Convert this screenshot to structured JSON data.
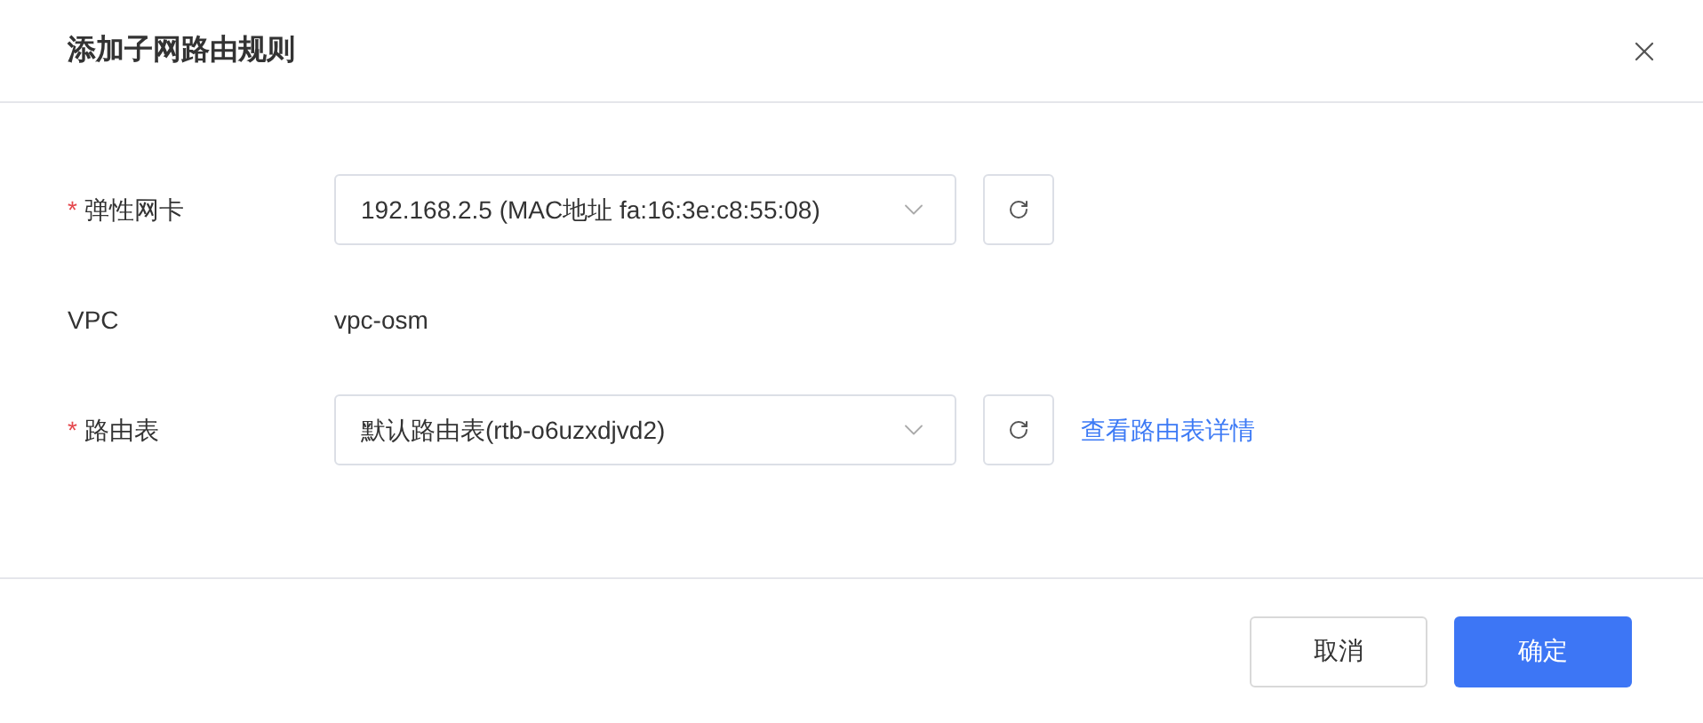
{
  "dialog": {
    "title": "添加子网路由规则",
    "required_marker": "*"
  },
  "fields": [
    {
      "kind": "select",
      "label": "弹性网卡",
      "required": true,
      "value": "192.168.2.5 (MAC地址 fa:16:3e:c8:55:08)"
    },
    {
      "kind": "text",
      "label": "VPC",
      "required": false,
      "value": "vpc-osm"
    },
    {
      "kind": "select",
      "label": "路由表",
      "required": true,
      "value": "默认路由表(rtb-o6uzxdjvd2)",
      "link": "查看路由表详情"
    }
  ],
  "buttons": [
    {
      "label": "取消",
      "kind": "secondary"
    },
    {
      "label": "确定",
      "kind": "primary"
    }
  ]
}
